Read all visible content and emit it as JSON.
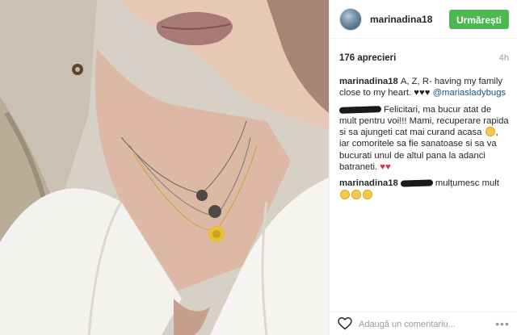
{
  "photo": {
    "alt_semantic": "selfie-photo"
  },
  "header": {
    "username": "marinadina18",
    "follow_label": "Urmărești"
  },
  "post": {
    "likes": "176 aprecieri",
    "time": "4h"
  },
  "comments": [
    {
      "user": "marinadina18",
      "text": "A, Z, R- having my family close to my heart. ♥♥♥",
      "mention": "@mariasladybugs"
    },
    {
      "user": "",
      "text": "Felicitari, ma bucur atat de mult pentru voi!!! Mami, recuperare rapida si sa ajungeti cat mai curand acasa",
      "text2": ", iar comoritele sa fie sanatoase si sa va bucurati unul de altul pana la adanci batraneti.",
      "hearts": "♥♥"
    },
    {
      "user": "marinadina18",
      "text": "mulțumesc mult"
    }
  ],
  "footer": {
    "comment_placeholder": "Adaugă un comentariu...",
    "more_label": "•••"
  },
  "colors": {
    "follow_button": "#4cb84f",
    "mention": "#125688",
    "heart": "#e8294b"
  }
}
